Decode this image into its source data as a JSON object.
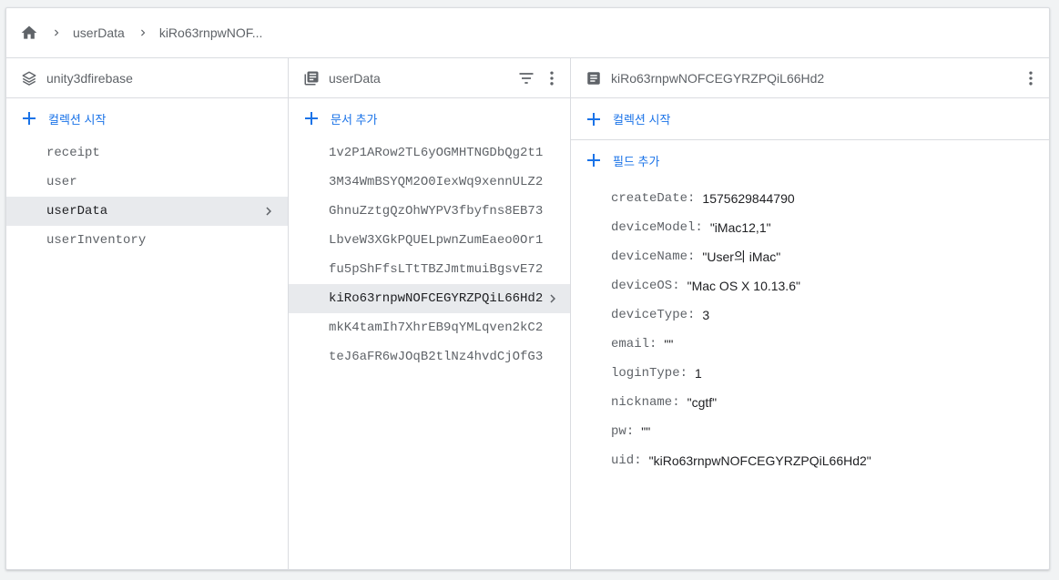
{
  "breadcrumb": {
    "items": [
      "userData",
      "kiRo63rnpwNOF..."
    ]
  },
  "panels": {
    "root": {
      "title": "unity3dfirebase",
      "add_label": "컬렉션 시작",
      "collections": [
        "receipt",
        "user",
        "userData",
        "userInventory"
      ],
      "selected_index": 2
    },
    "collection": {
      "title": "userData",
      "add_label": "문서 추가",
      "documents": [
        "1v2P1ARow2TL6yOGMHTNGDbQg2t1",
        "3M34WmBSYQM2O0IexWq9xennULZ2",
        "GhnuZztgQzOhWYPV3fbyfns8EB73",
        "LbveW3XGkPQUELpwnZumEaeo0Or1",
        "fu5pShFfsLTtTBZJmtmuiBgsvE72",
        "kiRo63rnpwNOFCEGYRZPQiL66Hd2",
        "mkK4tamIh7XhrEB9qYMLqven2kC2",
        "teJ6aFR6wJOqB2tlNz4hvdCjOfG3"
      ],
      "selected_index": 5
    },
    "document": {
      "title": "kiRo63rnpwNOFCEGYRZPQiL66Hd2",
      "add_collection_label": "컬렉션 시작",
      "add_field_label": "필드 추가",
      "fields": [
        {
          "key": "createDate",
          "value": "1575629844790"
        },
        {
          "key": "deviceModel",
          "value": "\"iMac12,1\""
        },
        {
          "key": "deviceName",
          "value": "\"User의 iMac\""
        },
        {
          "key": "deviceOS",
          "value": "\"Mac OS X 10.13.6\""
        },
        {
          "key": "deviceType",
          "value": "3"
        },
        {
          "key": "email",
          "value": "\"\""
        },
        {
          "key": "loginType",
          "value": "1"
        },
        {
          "key": "nickname",
          "value": "\"cgtf\""
        },
        {
          "key": "pw",
          "value": "\"\""
        },
        {
          "key": "uid",
          "value": "\"kiRo63rnpwNOFCEGYRZPQiL66Hd2\""
        }
      ]
    }
  },
  "icons": {
    "home": "home-icon",
    "breadcrumb_separator": "chevron-right-icon",
    "root": "stack-icon",
    "collection": "collection-icon",
    "document": "document-icon",
    "filter": "filter-icon",
    "more": "more-vert-icon",
    "add": "plus-icon"
  },
  "colors": {
    "accent": "#1a73e8",
    "selected_bg": "#e8eaed",
    "text_secondary": "#5f6368",
    "border": "#dadce0"
  }
}
